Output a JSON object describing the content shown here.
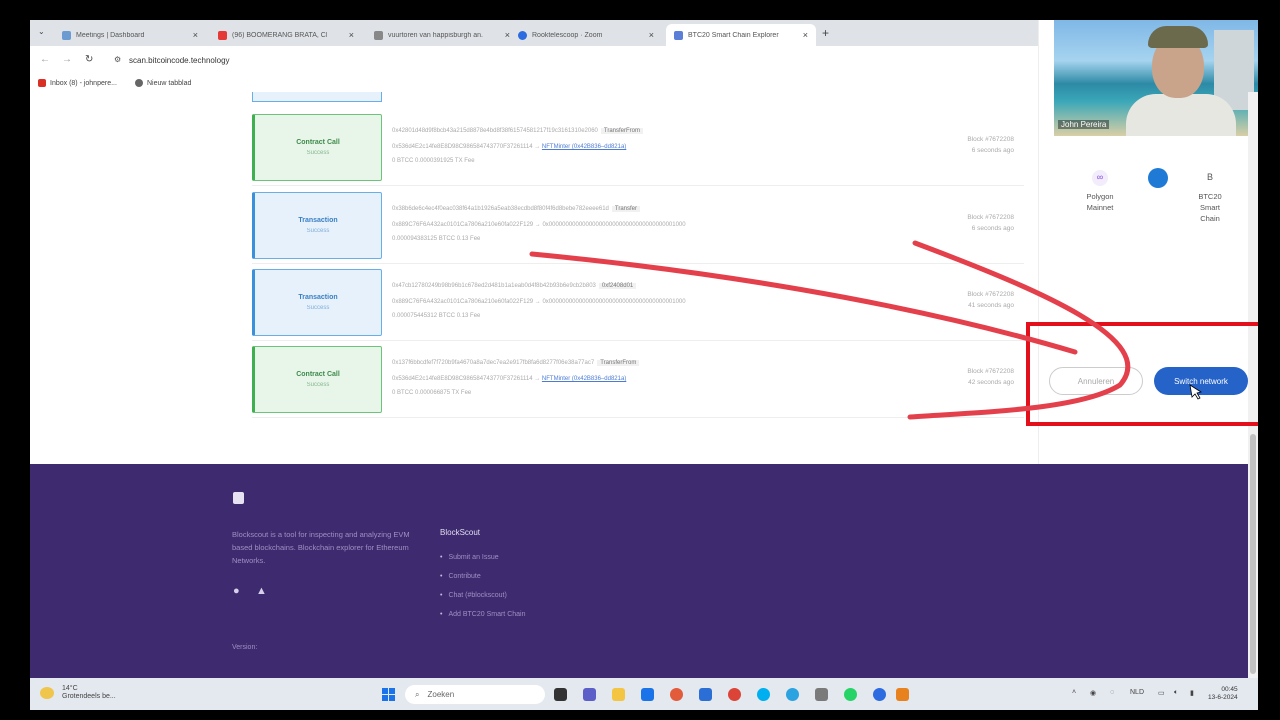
{
  "browser": {
    "tabs": [
      {
        "label": "Meetings | Dashboard",
        "color": "#6c9bd2"
      },
      {
        "label": "(96) BOOMERANG BRATA, CE...",
        "color": "#e53935"
      },
      {
        "label": "vuurtoren van happisburgh an...",
        "color": "#888888"
      },
      {
        "label": "Rooktelescoop · Zoom",
        "color": "#2d6be0"
      },
      {
        "label": "BTC20 Smart Chain Explorer",
        "color": "#5b7fd6"
      }
    ],
    "new_tab_label": "+",
    "url": "scan.bitcoincode.technology",
    "bookmarks": [
      "Inbox (8) - johnpere...",
      "Nieuw tabblad"
    ]
  },
  "transactions": [
    {
      "type": "Contract Call",
      "status": "Success",
      "hash": "0x42801d48d9f8bcb43a215d8878e4bd8f38f61574581217f19c3161310e2060",
      "method": "TransferFrom",
      "route": "0x536d4E2c14fe8E8D98C986584743770F37261114 →",
      "route_link": "NFTMinter (0x42B836–dd821a)",
      "value": "0 BTCC  0.0000391925 TX Fee",
      "block": "Block #7672208",
      "age": "6 seconds ago"
    },
    {
      "type": "Transaction",
      "status": "Success",
      "hash": "0x38b6de6c4ec4f0eac038f64a1b1926a5eab38ecdbd8f80f4f6d8bebe782eeee61d",
      "method": "Transfer",
      "route": "0x889C76F6A432ac0101Ca7806a210e60fa022F129 → 0x00000000000000000000000000000000000001000",
      "route_link": "",
      "value": "0.000094383125 BTCC  0.13 Fee",
      "block": "Block #7672208",
      "age": "6 seconds ago"
    },
    {
      "type": "Transaction",
      "status": "Success",
      "hash": "0x47cb12780249b98b96b1c678ed2d481b1a1eab0d4f8b42b93b6e9cb2b803",
      "method": "0xf2408d01",
      "route": "0x889C76F6A432ac0101Ca7806a210e60fa022F129 → 0x00000000000000000000000000000000000001000",
      "route_link": "",
      "value": "0.000075445312 BTCC  0.13 Fee",
      "block": "Block #7672208",
      "age": "41 seconds ago"
    },
    {
      "type": "Contract Call",
      "status": "Success",
      "hash": "0x137f6bbcdfef7f720b9fa4670a8a7dec7ea2e917fb8fa6d8277f06e38a77ac7",
      "method": "TransferFrom",
      "route": "0x536d4E2c14fe8E8D98C986584743770F37261114 →",
      "route_link": "NFTMinter (0x42B836–dd821a)",
      "value": "0 BTCC  0.000066875 TX Fee",
      "block": "Block #7672208",
      "age": "42 seconds ago"
    }
  ],
  "network_prompt": {
    "from": {
      "name": "Polygon Mainnet",
      "icon": "polygon-icon"
    },
    "to": {
      "name": "BTC20 Smart Chain",
      "icon_letter": "B"
    },
    "cancel_label": "Annuleren",
    "switch_label": "Switch network"
  },
  "webcam": {
    "participant": "John Pereira"
  },
  "footer": {
    "description": "Blockscout is a tool for inspecting and analyzing EVM based blockchains. Blockchain explorer for Ethereum Networks.",
    "heading": "BlockScout",
    "links": [
      "Submit an Issue",
      "Contribute",
      "Chat (#blockscout)",
      "Add BTC20 Smart Chain"
    ],
    "version_label": "Version:"
  },
  "taskbar": {
    "temperature": "14°C",
    "weather": "Grotendeels be...",
    "search_placeholder": "Zoeken",
    "language": "NLD",
    "time": "00:45",
    "date": "13-6-2024"
  },
  "colors": {
    "annotation_red": "#e3101b",
    "switch_blue": "#2563c9",
    "footer_purple": "#3e2a6e"
  }
}
